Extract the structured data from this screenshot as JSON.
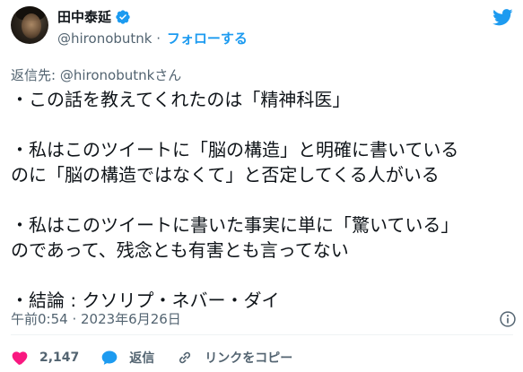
{
  "author": {
    "name": "田中泰延",
    "handle": "@hironobutnk",
    "separator": "·",
    "follow_label": "フォローする"
  },
  "reply_to": "返信先: @hironobutnkさん",
  "body_lines": [
    "・この話を教えてくれたのは「精神科医」",
    "",
    "・私はこのツイートに「脳の構造」と明確に書いている",
    "のに「脳の構造ではなくて」と否定してくる人がいる",
    "",
    "・私はこのツイートに書いた事実に単に「驚いている」",
    "のであって、残念とも有害とも言ってない",
    "",
    "・結論 : クソリプ・ネバー・ダイ"
  ],
  "timestamp": "午前0:54 · 2023年6月26日",
  "actions": {
    "like_count": "2,147",
    "reply_label": "返信",
    "copy_link_label": "リンクをコピー"
  },
  "colors": {
    "accent": "#1d9bf0",
    "like": "#f91880",
    "secondary_text": "#536471",
    "divider": "#eff3f4"
  },
  "icons": {
    "avatar": "profile-photo",
    "verified": "verified-badge-icon",
    "brand": "twitter-bird-icon",
    "info": "info-icon",
    "like": "heart-icon",
    "reply": "speech-bubble-icon",
    "copy_link": "link-icon"
  }
}
